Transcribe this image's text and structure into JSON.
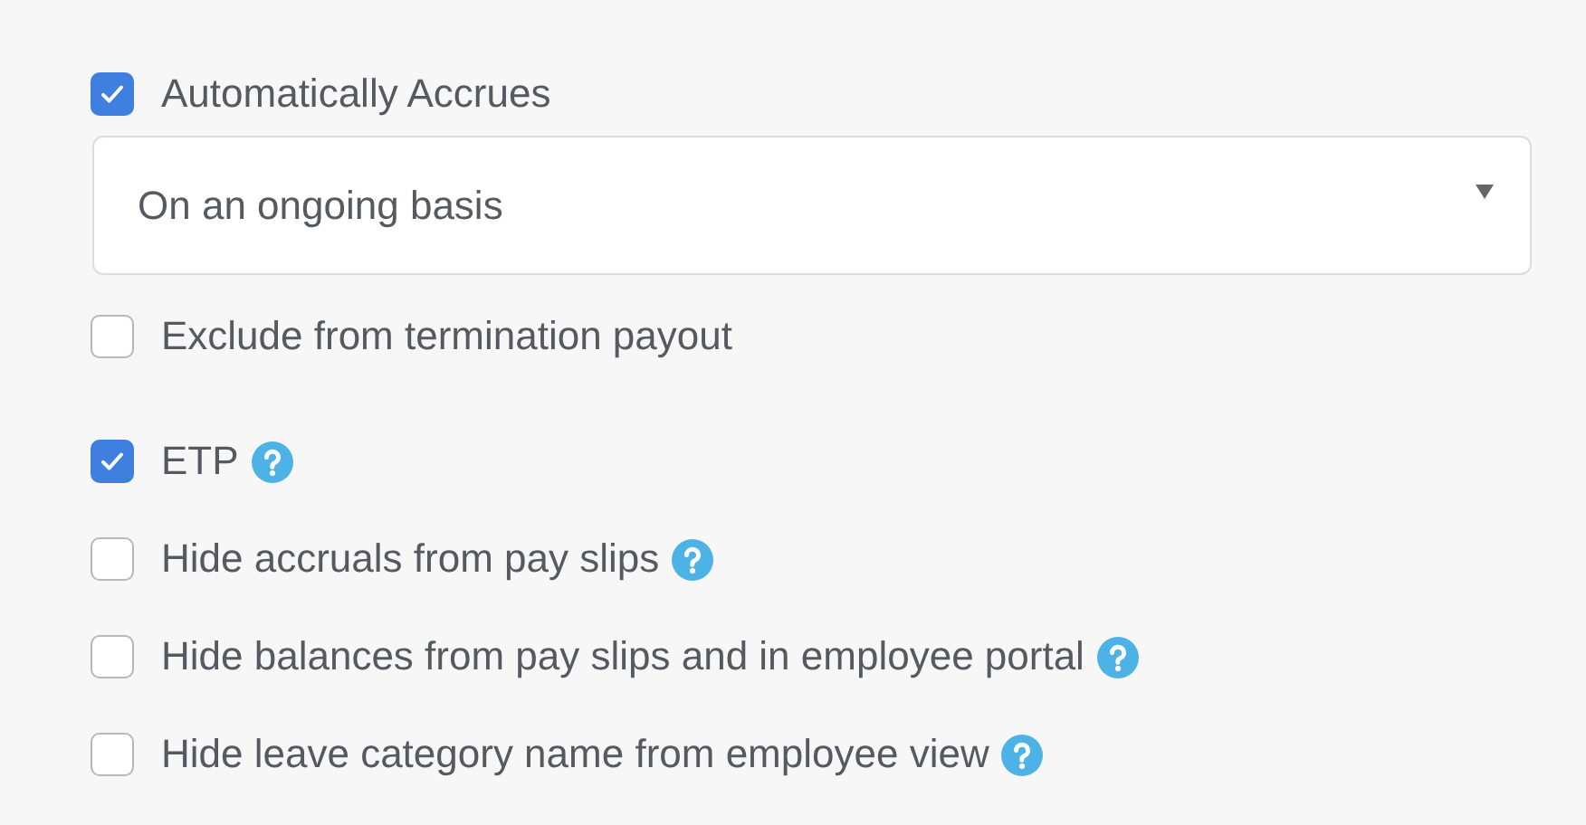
{
  "sections": [
    {
      "items": [
        {
          "kind": "checkbox",
          "label": "Automatically Accrues",
          "checked": true,
          "help": false
        },
        {
          "kind": "select",
          "value": "On an ongoing basis"
        },
        {
          "kind": "checkbox",
          "label": "Exclude from termination payout",
          "checked": false,
          "help": false
        }
      ]
    },
    {
      "items": [
        {
          "kind": "checkbox",
          "label": "ETP",
          "checked": true,
          "help": true
        },
        {
          "kind": "checkbox",
          "label": "Hide accruals from pay slips",
          "checked": false,
          "help": true
        },
        {
          "kind": "checkbox",
          "label": "Hide balances from pay slips and in employee portal",
          "checked": false,
          "help": true
        },
        {
          "kind": "checkbox",
          "label": "Hide leave category name from employee view",
          "checked": false,
          "help": true
        }
      ]
    }
  ]
}
